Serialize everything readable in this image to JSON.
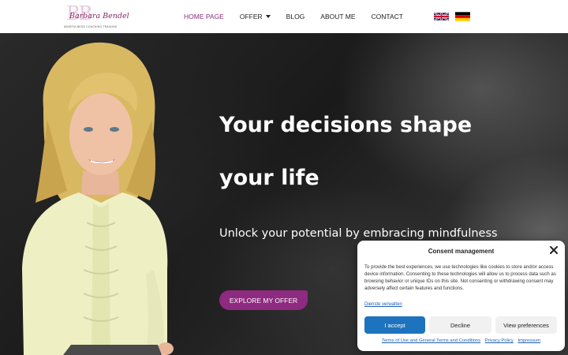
{
  "header": {
    "logo": {
      "monogram": "BB",
      "name": "Barbara Bendel",
      "tagline": "MINDFULNESS COACHING TRAINING"
    },
    "nav": [
      {
        "label": "HOME PAGE",
        "active": true
      },
      {
        "label": "OFFER",
        "has_dropdown": true
      },
      {
        "label": "BLOG"
      },
      {
        "label": "ABOUT ME"
      },
      {
        "label": "CONTACT"
      }
    ],
    "flags": [
      "uk-flag-icon",
      "germany-flag-icon"
    ]
  },
  "hero": {
    "title_line1": "Your decisions shape",
    "title_line2": "your life",
    "subtitle": "Unlock your potential by embracing mindfulness",
    "cta_label": "EXPLORE MY OFFER"
  },
  "consent": {
    "title": "Consent management",
    "body": "To provide the best experiences, we use technologies like cookies to store and/or access device information. Consenting to these technologies will allow us to process data such as browsing behavior or unique IDs on this site. Not consenting or withdrawing consent may adversely affect certain features and functions.",
    "manage_link": "Dienste verwalten",
    "accept_label": "I accept",
    "decline_label": "Decline",
    "preferences_label": "View preferences",
    "links": [
      "Terms of Use and General Terms and Conditions",
      "Privacy Policy",
      "Impressum"
    ]
  },
  "colors": {
    "accent": "#8e2a80",
    "nav_active": "#8a2d7a",
    "primary_button": "#1e73be"
  }
}
